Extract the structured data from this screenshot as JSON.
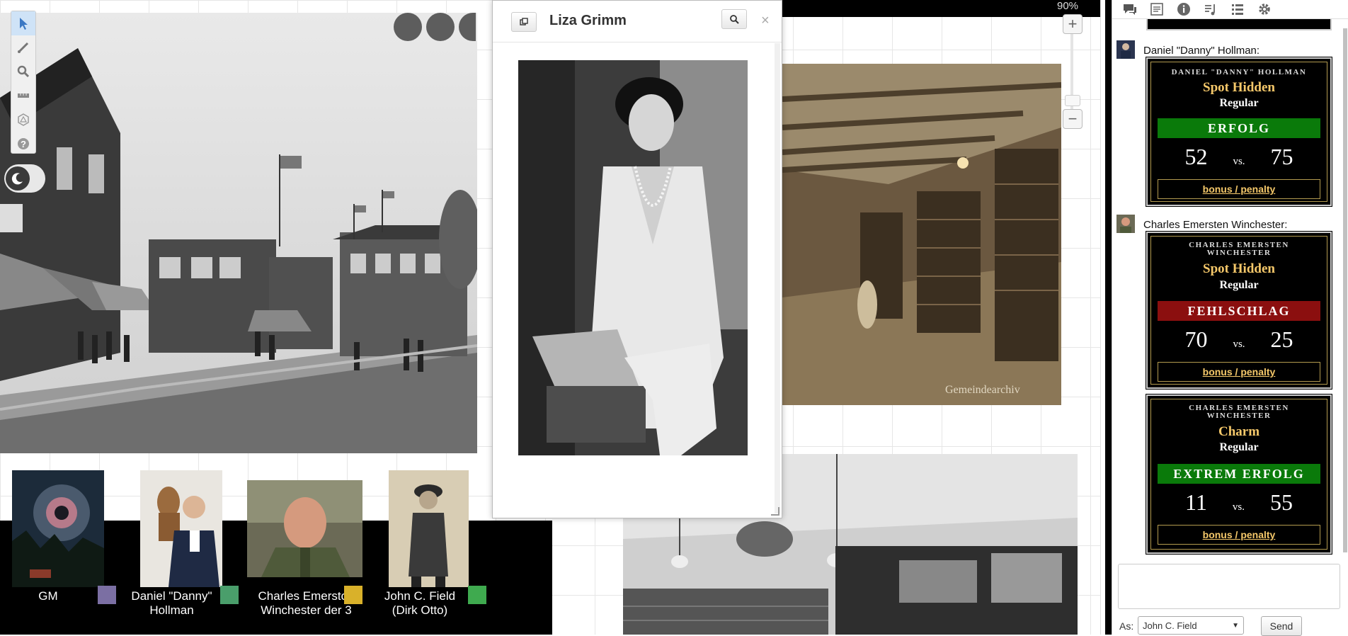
{
  "zoom_level": "90%",
  "handout": {
    "title": "Liza Grimm",
    "popout_icon": "popout-icon",
    "search_icon": "search-icon",
    "close_label": "×"
  },
  "map": {
    "watermark": "Gemeindearchiv"
  },
  "players": [
    {
      "name": "GM",
      "color": "#7b6fa3"
    },
    {
      "name": "Daniel \"Danny\" Hollman",
      "color": "#4a9e6b"
    },
    {
      "name": "Charles Emerston Winchester der 3",
      "color": "#d9b12a"
    },
    {
      "name": "John C. Field (Dirk Otto)",
      "color": "#3faa4f"
    }
  ],
  "chat": {
    "messages": [
      {
        "speaker": "Daniel \"Danny\" Hollman:",
        "cards": [
          {
            "character": "Daniel \"Danny\" Hollman",
            "skill": "Spot Hidden",
            "difficulty": "Regular",
            "result": "ERFOLG",
            "result_color": "#0a7a0a",
            "roll": "52",
            "vs": "vs.",
            "target": "75",
            "bonus": "bonus / penalty"
          }
        ]
      },
      {
        "speaker": "Charles Emersten Winchester:",
        "cards": [
          {
            "character": "Charles Emersten Winchester",
            "skill": "Spot Hidden",
            "difficulty": "Regular",
            "result": "FEHLSCHLAG",
            "result_color": "#8b0f0f",
            "roll": "70",
            "vs": "vs.",
            "target": "25",
            "bonus": "bonus / penalty"
          },
          {
            "character": "Charles Emersten Winchester",
            "skill": "Charm",
            "difficulty": "Regular",
            "result": "EXTREM ERFOLG",
            "result_color": "#0a7a0a",
            "roll": "11",
            "vs": "vs.",
            "target": "55",
            "bonus": "bonus / penalty"
          }
        ]
      }
    ],
    "as_label": "As:",
    "as_value": "John C. Field",
    "send_label": "Send"
  },
  "sidebar_tabs": [
    "chat-icon",
    "journal-icon",
    "info-icon",
    "jukebox-icon",
    "collections-icon",
    "settings-icon"
  ],
  "toolbar_tools": [
    "select-icon",
    "draw-icon",
    "zoom-icon",
    "measure-icon",
    "dice-icon",
    "help-icon"
  ]
}
